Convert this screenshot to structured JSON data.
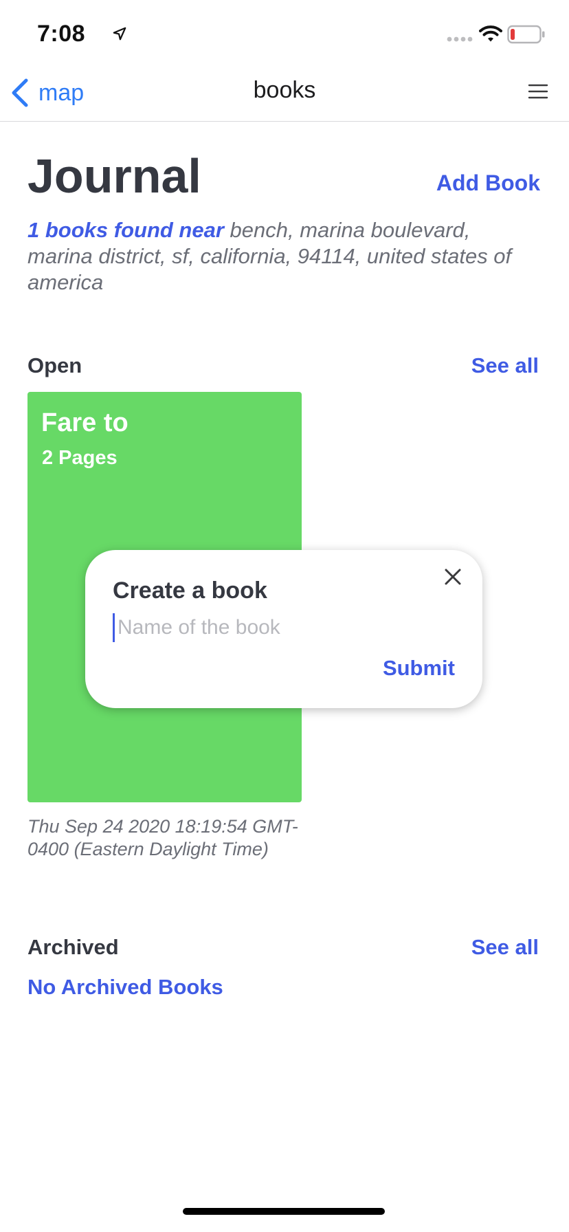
{
  "status_bar": {
    "time": "7:08",
    "icons": [
      "location-arrow-icon",
      "signal-icon",
      "wifi-icon",
      "battery-icon"
    ],
    "battery_color": "#e23b3b"
  },
  "nav": {
    "back_label": "map",
    "title": "books",
    "menu_icon": "hamburger-menu-icon"
  },
  "header": {
    "title": "Journal",
    "add_book_label": "Add Book",
    "found_count_text": "1 books found near",
    "location": "bench, marina boulevard, marina district, sf, california, 94114, united states of america"
  },
  "open_section": {
    "label": "Open",
    "see_all_label": "See all",
    "books": [
      {
        "title": "Fare to",
        "pages": "2 Pages",
        "date": "Thu Sep 24 2020 18:19:54 GMT-0400 (Eastern Daylight Time)",
        "color": "#67d966"
      }
    ]
  },
  "archived_section": {
    "label": "Archived",
    "see_all_label": "See all",
    "empty_text": "No Archived Books"
  },
  "modal": {
    "title": "Create a book",
    "input_placeholder": "Name of the book",
    "input_value": "",
    "submit_label": "Submit",
    "close_icon": "close-icon"
  },
  "colors": {
    "accent": "#3f5be4",
    "nav_link": "#2f7cf6",
    "text_dark": "#353841",
    "text_muted": "#6b6e77"
  }
}
